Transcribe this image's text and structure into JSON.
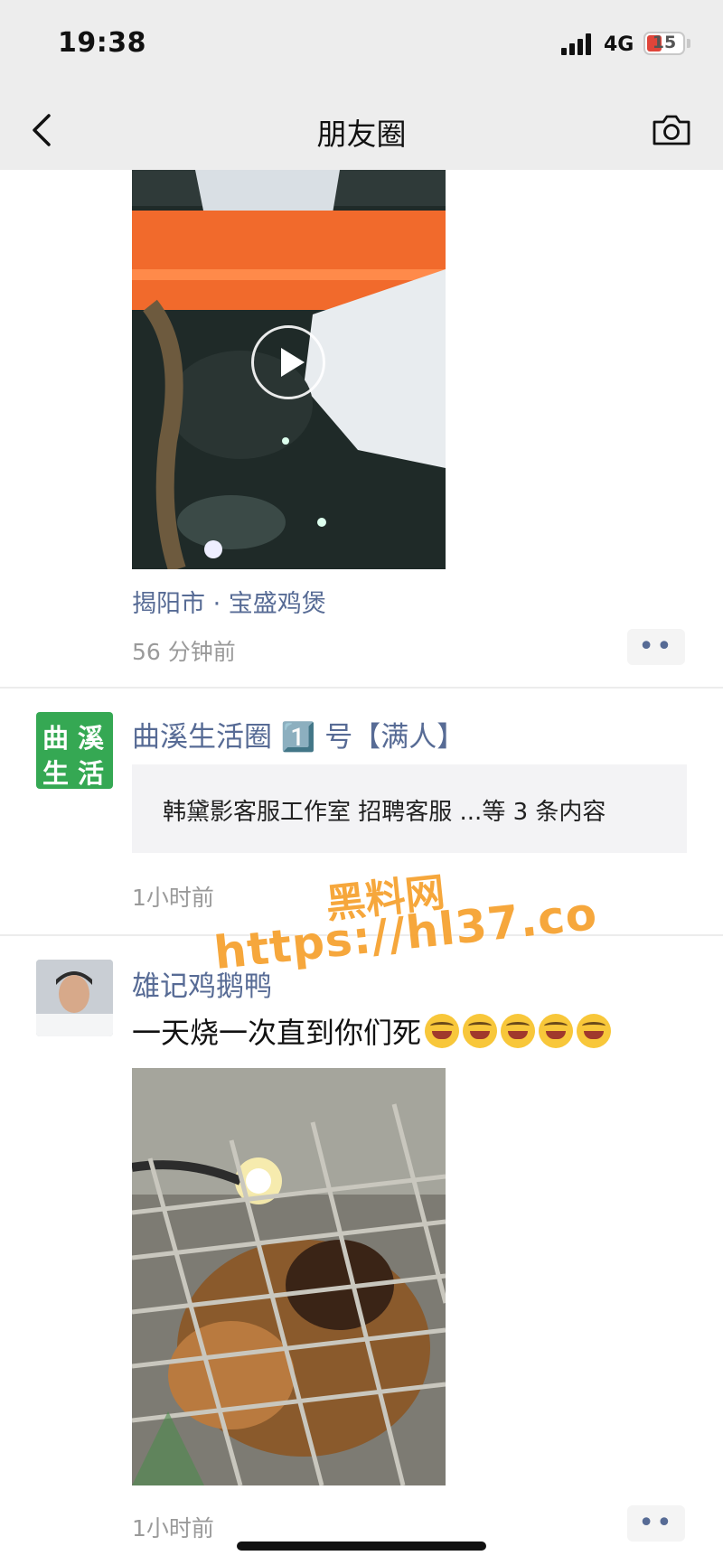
{
  "status": {
    "time": "19:38",
    "network": "4G",
    "battery": "15"
  },
  "nav": {
    "title": "朋友圈"
  },
  "post1": {
    "location": "揭阳市 · 宝盛鸡煲",
    "time": "56 分钟前",
    "more": "••"
  },
  "post2": {
    "avatar_line1": [
      "曲",
      "溪"
    ],
    "avatar_line2": [
      "生",
      "活"
    ],
    "name": "曲溪生活圈 1️⃣ 号【满人】",
    "share": "韩黛影客服工作室 招聘客服 ...等 3 条内容",
    "time": "1小时前"
  },
  "post3": {
    "name": "雄记鸡鹅鸭",
    "text": "一天烧一次直到你们死",
    "time": "1小时前",
    "more": "••"
  },
  "watermark": {
    "line1": "黑料网",
    "line2": "https://hl37.co"
  }
}
